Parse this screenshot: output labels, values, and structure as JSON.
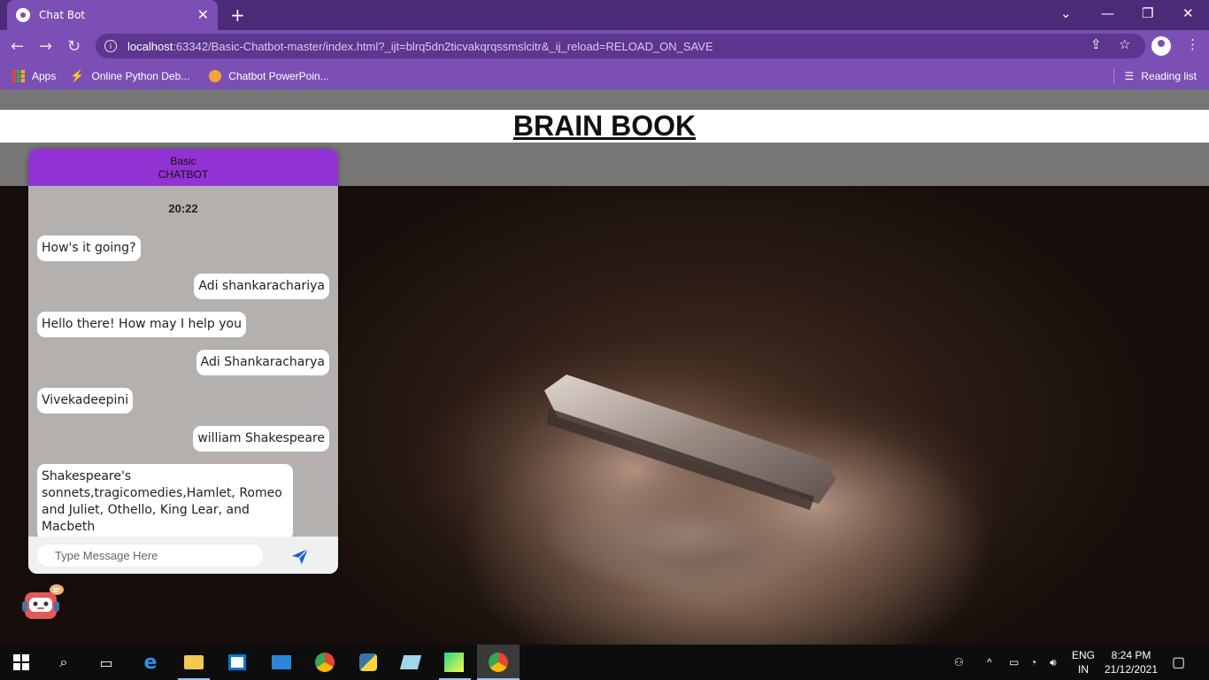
{
  "browser": {
    "tab_title": "Chat Bot",
    "tab_close": "✕",
    "new_tab": "+",
    "url_host": "localhost",
    "url_rest": ":63342/Basic-Chatbot-master/index.html?_ijt=blrq5dn2ticvakqrqssmslcitr&_ij_reload=RELOAD_ON_SAVE",
    "bookmarks": [
      {
        "label": "Apps",
        "icon": "apps-grid-icon"
      },
      {
        "label": "Online Python Deb...",
        "icon": "bolt-icon"
      },
      {
        "label": "Chatbot PowerPoin...",
        "icon": "powerpoint-icon"
      }
    ],
    "reading_list": "Reading list"
  },
  "page": {
    "brand": "BRAIN BOOK"
  },
  "chat": {
    "header_line1": "Basic",
    "header_line2": "CHATBOT",
    "time": "20:22",
    "messages": [
      {
        "from": "bot",
        "text": "How's it going?"
      },
      {
        "from": "user",
        "text": "Adi shankarachariya"
      },
      {
        "from": "bot",
        "text": "Hello there! How may I help you"
      },
      {
        "from": "user",
        "text": "Adi Shankaracharya"
      },
      {
        "from": "bot",
        "text": "Vivekadeepini"
      },
      {
        "from": "user",
        "text": "william Shakespeare"
      },
      {
        "from": "bot",
        "text": "Shakespeare's sonnets,tragicomedies,Hamlet, Romeo and Juliet, Othello, King Lear, and Macbeth"
      }
    ],
    "input_placeholder": "Type Message Here",
    "accent": "#9232d3"
  },
  "taskbar": {
    "lang_line1": "ENG",
    "lang_line2": "IN",
    "time": "8:24 PM",
    "date": "21/12/2021"
  }
}
